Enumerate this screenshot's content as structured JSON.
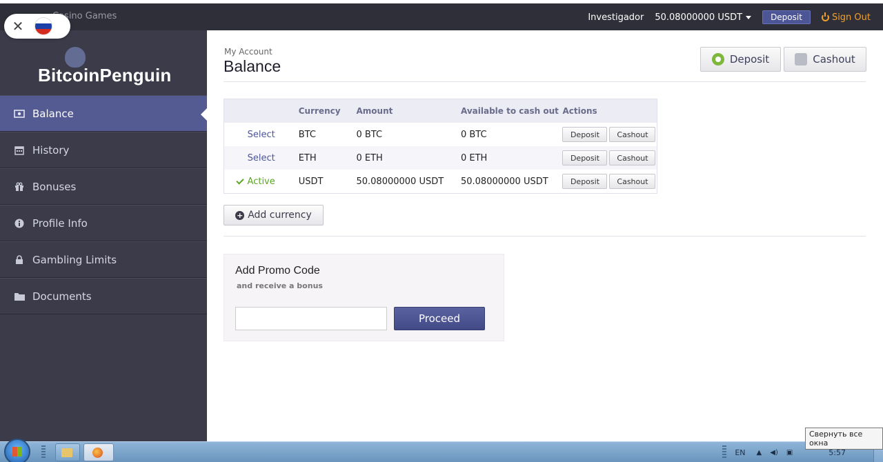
{
  "topbar": {
    "casino_games": "Casino Games",
    "username": "Investigador",
    "balance": "50.08000000 USDT",
    "deposit_label": "Deposit",
    "signout_label": "Sign Out"
  },
  "brand": {
    "logo_text": "BitcoinPenguin"
  },
  "sidebar": {
    "items": [
      {
        "label": "Balance",
        "icon": "money-icon"
      },
      {
        "label": "History",
        "icon": "calendar-icon"
      },
      {
        "label": "Bonuses",
        "icon": "gift-icon"
      },
      {
        "label": "Profile Info",
        "icon": "info-icon"
      },
      {
        "label": "Gambling Limits",
        "icon": "lock-icon"
      },
      {
        "label": "Documents",
        "icon": "folder-icon"
      }
    ]
  },
  "main": {
    "breadcrumb": "My Account",
    "title": "Balance",
    "deposit_btn": "Deposit",
    "cashout_btn": "Cashout",
    "table": {
      "headers": [
        "",
        "Currency",
        "Amount",
        "Available to cash out",
        "Actions"
      ],
      "rows": [
        {
          "status": "Select",
          "currency": "BTC",
          "amount": "0 BTC",
          "available": "0 BTC",
          "deposit": "Deposit",
          "cashout": "Cashout"
        },
        {
          "status": "Select",
          "currency": "ETH",
          "amount": "0 ETH",
          "available": "0 ETH",
          "deposit": "Deposit",
          "cashout": "Cashout"
        },
        {
          "status": "Active",
          "currency": "USDT",
          "amount": "50.08000000 USDT",
          "available": "50.08000000 USDT",
          "deposit": "Deposit",
          "cashout": "Cashout"
        }
      ]
    },
    "add_currency": "Add currency",
    "promo": {
      "heading": "Add Promo Code",
      "subheading": "and receive a bonus",
      "input_value": "",
      "proceed": "Proceed"
    }
  },
  "taskbar": {
    "lang": "EN",
    "time": "5:57",
    "tooltip": "Свернуть все окна"
  },
  "colors": {
    "sidebar_bg": "#3b3b4a",
    "accent": "#4c5596",
    "active_green": "#5aa623",
    "signout_orange": "#f0a12c"
  }
}
